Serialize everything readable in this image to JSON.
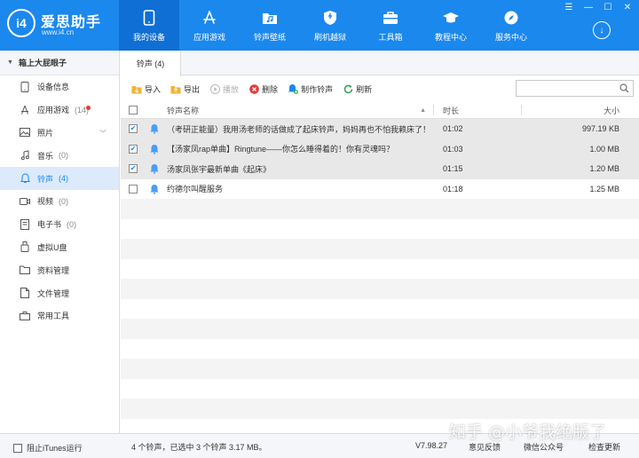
{
  "app": {
    "logo_mark": "i4",
    "title": "爱思助手",
    "url": "www.i4.cn"
  },
  "nav": [
    {
      "label": "我的设备",
      "icon": "phone-icon",
      "active": true
    },
    {
      "label": "应用游戏",
      "icon": "app-store-icon",
      "active": false
    },
    {
      "label": "铃声壁纸",
      "icon": "music-folder-icon",
      "active": false
    },
    {
      "label": "刷机越狱",
      "icon": "shield-icon",
      "active": false
    },
    {
      "label": "工具箱",
      "icon": "toolbox-icon",
      "active": false
    },
    {
      "label": "教程中心",
      "icon": "graduation-cap-icon",
      "active": false
    },
    {
      "label": "服务中心",
      "icon": "compass-icon",
      "active": false
    }
  ],
  "window_controls": [
    "☰",
    "—",
    "☐",
    "✕"
  ],
  "download_symbol": "↓",
  "sidebar": {
    "device_name": "箱上大屁眼子",
    "items": [
      {
        "label": "设备信息",
        "icon": "phone-info-icon",
        "count": ""
      },
      {
        "label": "应用游戏",
        "icon": "app-icon",
        "count": "(14)"
      },
      {
        "label": "照片",
        "icon": "photo-icon",
        "count": ""
      },
      {
        "label": "音乐",
        "icon": "music-note-icon",
        "count": "(0)"
      },
      {
        "label": "铃声",
        "icon": "bell-icon",
        "count": "(4)"
      },
      {
        "label": "视频",
        "icon": "video-icon",
        "count": "(0)"
      },
      {
        "label": "电子书",
        "icon": "ebook-icon",
        "count": "(0)"
      },
      {
        "label": "虚拟U盘",
        "icon": "usb-icon",
        "count": ""
      },
      {
        "label": "资料管理",
        "icon": "folder-icon",
        "count": ""
      },
      {
        "label": "文件管理",
        "icon": "file-icon",
        "count": ""
      },
      {
        "label": "常用工具",
        "icon": "tools-icon",
        "count": ""
      }
    ]
  },
  "tab": {
    "label": "铃声 (4)"
  },
  "toolbar": {
    "import": "导入",
    "export": "导出",
    "play": "播放",
    "delete": "删除",
    "make_ringtone": "制作铃声",
    "refresh": "刷新",
    "search_placeholder": ""
  },
  "table": {
    "headers": {
      "name": "铃声名称",
      "duration": "时长",
      "size": "大小"
    },
    "rows": [
      {
        "checked": true,
        "name": "（考研正能量）我用汤老师的话做成了起床铃声，妈妈再也不怕我赖床了！",
        "duration": "01:02",
        "size": "997.19 KB",
        "selected": true
      },
      {
        "checked": true,
        "name": "【汤家凤rap单曲】Ringtune——你怎么睡得着的！你有灵魂吗？",
        "duration": "01:03",
        "size": "1.00 MB",
        "selected": true
      },
      {
        "checked": true,
        "name": "汤家凤张宇最新单曲《起床》",
        "duration": "01:15",
        "size": "1.20 MB",
        "selected": true
      },
      {
        "checked": false,
        "name": "约德尔叫醒服务",
        "duration": "01:18",
        "size": "1.25 MB",
        "selected": false
      }
    ]
  },
  "statusbar": {
    "block_itunes": "阻止iTunes运行",
    "info": "4 个铃声，已选中 3 个铃声 3.17 MB。",
    "version": "V7.98.27",
    "feedback": "意见反馈",
    "wechat": "微信公众号",
    "update": "检查更新"
  },
  "watermark": "知乎 @小爷我绝版了",
  "colors": {
    "brand": "#1b88ee",
    "active_nav": "#0f6fd4",
    "delete_red": "#e53935",
    "refresh_green": "#2e9e4f",
    "folder_yellow": "#f2b233"
  }
}
